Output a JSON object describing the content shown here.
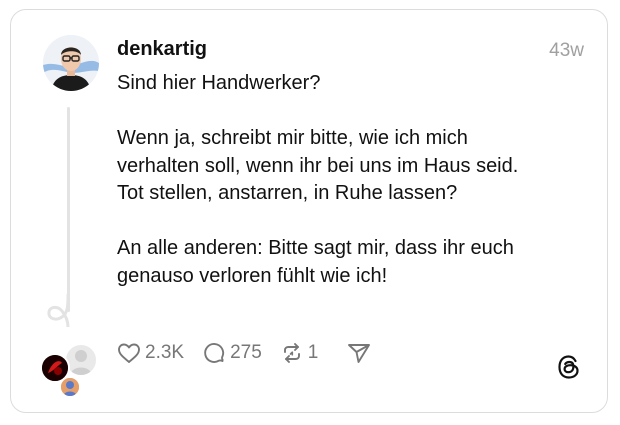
{
  "post": {
    "username": "denkartig",
    "time": "43w",
    "paragraphs": [
      [
        "Sind hier Handwerker?"
      ],
      [
        "Wenn ja, schreibt mir bitte, wie ich mich",
        "verhalten soll, wenn ihr bei uns im Haus seid.",
        "Tot stellen, anstarren, in Ruhe lassen?"
      ],
      [
        "An alle anderen: Bitte sagt mir, dass ihr euch",
        "genauso verloren fühlt wie ich!"
      ]
    ]
  },
  "actions": {
    "likes": "2.3K",
    "replies": "275",
    "reposts": "1"
  },
  "icons": {
    "like": "heart-icon",
    "reply": "comment-icon",
    "repost": "repost-icon",
    "share": "send-icon",
    "brand": "threads-logo-icon"
  },
  "colors": {
    "text": "#111111",
    "muted": "#777777",
    "border": "#dcdcdc"
  }
}
